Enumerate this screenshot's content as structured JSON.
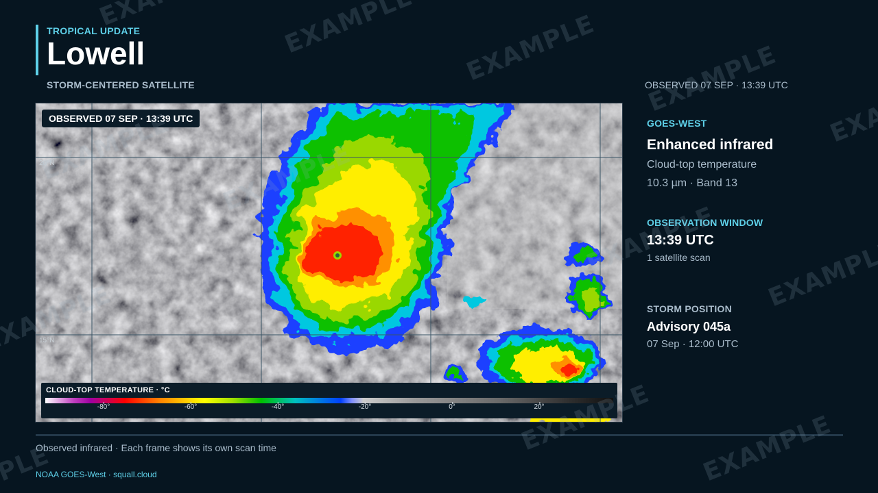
{
  "header": {
    "kicker": "TROPICAL UPDATE",
    "storm_name": "Lowell",
    "subtitle": "STORM-CENTERED SATELLITE",
    "observed_top": "OBSERVED 07 SEP · 13:39 UTC"
  },
  "map": {
    "observed_pill": "OBSERVED 07 SEP · 13:39 UTC",
    "lat_labels": [
      "20°N",
      "15°N"
    ],
    "legend": {
      "title": "CLOUD-TOP TEMPERATURE · °C",
      "ticks": [
        "-80°",
        "-60°",
        "-40°",
        "-20°",
        "0°",
        "20°"
      ]
    }
  },
  "sidebar": {
    "satellite": {
      "label": "GOES-WEST",
      "product": "Enhanced infrared",
      "description": "Cloud-top temperature",
      "band": "10.3 µm · Band 13"
    },
    "observation": {
      "label": "OBSERVATION WINDOW",
      "time": "13:39 UTC",
      "scans": "1 satellite scan"
    },
    "position": {
      "label": "STORM POSITION",
      "advisory": "Advisory 045a",
      "time": "07 Sep · 12:00 UTC"
    }
  },
  "footer": {
    "note": "Observed infrared · Each frame shows its own scan time",
    "credit": "NOAA GOES-West · squall.cloud"
  },
  "watermark": "EXAMPLE",
  "colors": {
    "background": "#061520",
    "accent": "#5ed0e8",
    "muted": "#a9bccb"
  }
}
